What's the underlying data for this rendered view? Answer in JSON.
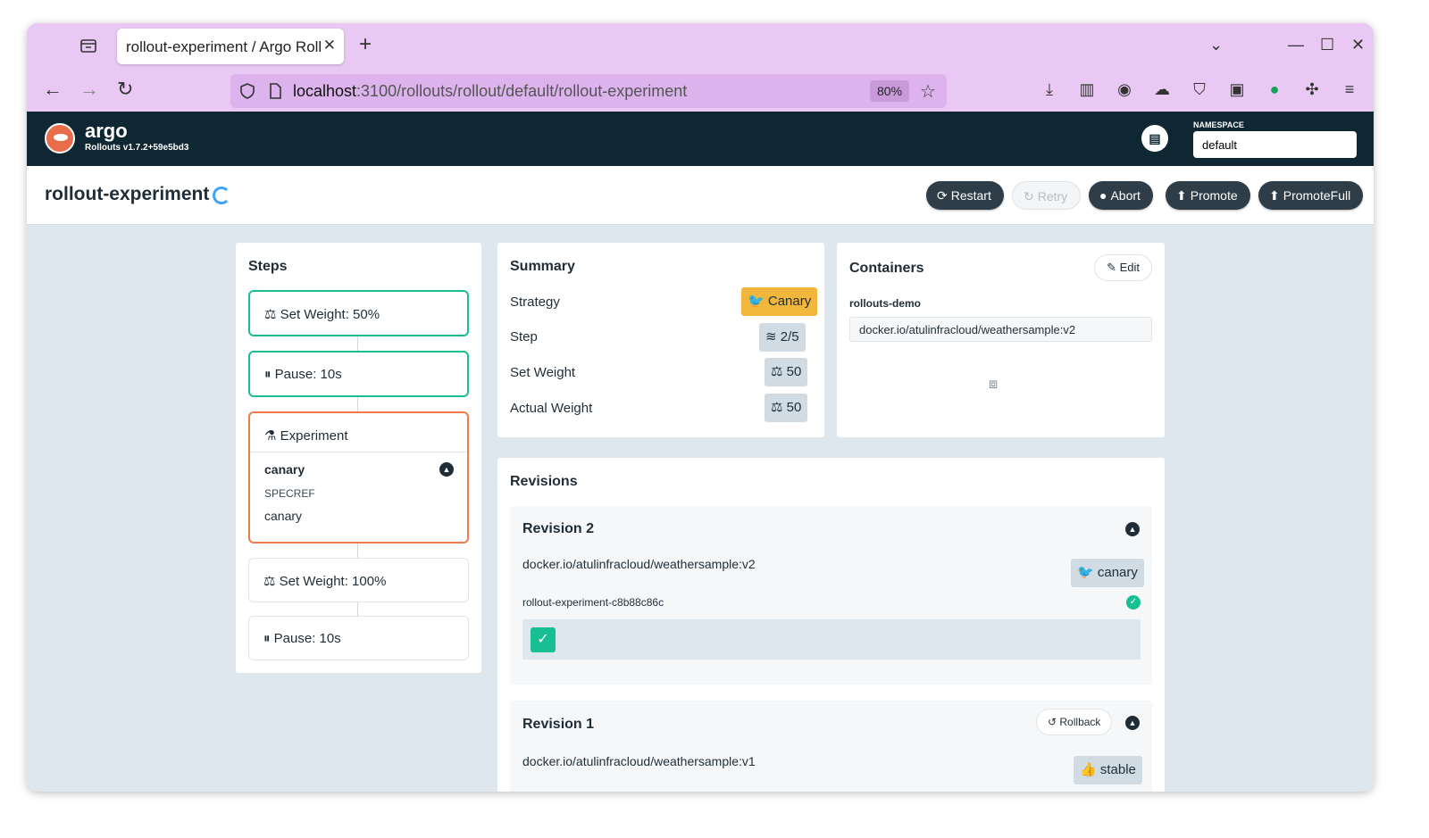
{
  "browser": {
    "tab_title": "rollout-experiment / Argo Rollouts",
    "url_host": "localhost",
    "url_path": ":3100/rollouts/rollout/default/rollout-experiment",
    "zoom": "80%"
  },
  "header": {
    "brand": "argo",
    "version": "Rollouts v1.7.2+59e5bd3",
    "namespace_label": "NAMESPACE",
    "namespace_value": "default"
  },
  "rollout": {
    "name": "rollout-experiment",
    "actions": {
      "restart": "Restart",
      "retry": "Retry",
      "abort": "Abort",
      "promote": "Promote",
      "promote_full": "PromoteFull"
    }
  },
  "steps": {
    "title": "Steps",
    "items": [
      {
        "label": "Set Weight: 50%",
        "icon": "weight-icon",
        "state": "done"
      },
      {
        "label": "Pause: 10s",
        "icon": "pause-icon",
        "state": "done"
      },
      {
        "label": "Experiment",
        "icon": "flask-icon",
        "state": "active"
      },
      {
        "label": "Set Weight: 100%",
        "icon": "weight-icon",
        "state": "pending"
      },
      {
        "label": "Pause: 10s",
        "icon": "pause-icon",
        "state": "pending"
      }
    ],
    "experiment": {
      "template_name": "canary",
      "specref_label": "SPECREF",
      "specref_value": "canary"
    }
  },
  "summary": {
    "title": "Summary",
    "strategy_label": "Strategy",
    "strategy_value": "Canary",
    "step_label": "Step",
    "step_value": "2/5",
    "set_weight_label": "Set Weight",
    "set_weight_value": "50",
    "actual_weight_label": "Actual Weight",
    "actual_weight_value": "50"
  },
  "containers": {
    "title": "Containers",
    "edit_label": "Edit",
    "name": "rollouts-demo",
    "image": "docker.io/atulinfracloud/weathersample:v2"
  },
  "revisions": {
    "title": "Revisions",
    "items": [
      {
        "title": "Revision 2",
        "image": "docker.io/atulinfracloud/weathersample:v2",
        "badge": "canary",
        "replicaset": "rollout-experiment-c8b88c86c"
      },
      {
        "title": "Revision 1",
        "rollback_label": "Rollback",
        "image": "docker.io/atulinfracloud/weathersample:v1",
        "badge": "stable"
      }
    ]
  },
  "colors": {
    "header_bg": "#0f2733",
    "success": "#18be94",
    "active_step": "#f07b4a",
    "canary_badge": "#f1b63c",
    "browser_chrome": "#e9c9f3"
  }
}
